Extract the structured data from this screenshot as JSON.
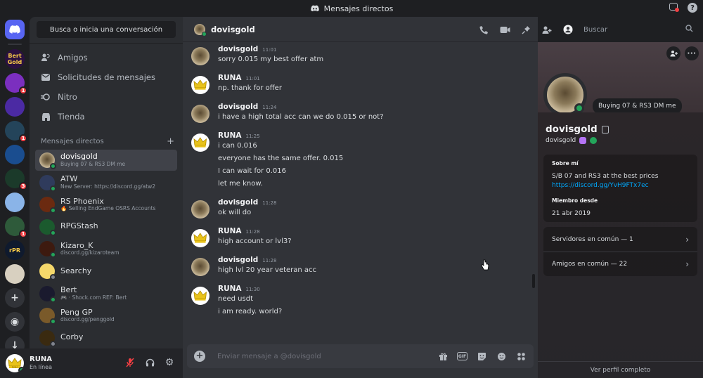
{
  "titlebar": {
    "title": "Mensajes directos"
  },
  "servers": [
    {
      "name": "discord-home",
      "label": "",
      "color": "#5865f2"
    },
    {
      "name": "bert-gold",
      "label": "Bert Gold",
      "color": "#2b1140"
    },
    {
      "name": "server-2",
      "label": "",
      "color": "#7b2fbf",
      "badge": "1"
    },
    {
      "name": "server-3",
      "label": "",
      "color": "#4b2aa3"
    },
    {
      "name": "server-4",
      "label": "",
      "color": "#24445a",
      "badge": "1"
    },
    {
      "name": "server-5",
      "label": "",
      "color": "#1a4d8f"
    },
    {
      "name": "server-6",
      "label": "",
      "color": "#1b3a2a",
      "badge": "3"
    },
    {
      "name": "server-7",
      "label": "",
      "color": "#8ab4e8"
    },
    {
      "name": "server-8",
      "label": "",
      "color": "#2e5a3a",
      "badge": "1"
    },
    {
      "name": "server-9",
      "label": "rPR",
      "color": "#0f1a2e"
    },
    {
      "name": "server-10",
      "label": "",
      "color": "#d8d0c0"
    }
  ],
  "sidebar": {
    "search_label": "Busca o inicia una conversación",
    "nav": [
      {
        "label": "Amigos",
        "icon": "friends-icon"
      },
      {
        "label": "Solicitudes de mensajes",
        "icon": "mail-icon"
      },
      {
        "label": "Nitro",
        "icon": "nitro-icon"
      },
      {
        "label": "Tienda",
        "icon": "shop-icon"
      }
    ],
    "dm_header": "Mensajes directos",
    "dms": [
      {
        "name": "dovisgold",
        "sub": "Buying 07 & RS3 DM me",
        "status": "online",
        "active": true
      },
      {
        "name": "ATW",
        "sub": "New Server: https://discord.gg/atw2",
        "status": "online"
      },
      {
        "name": "RS Phoenix",
        "sub": "🔥 Selling EndGame OSRS Accounts",
        "status": "online"
      },
      {
        "name": "RPGStash",
        "sub": "",
        "status": "online"
      },
      {
        "name": "Kizaro_K",
        "sub": "discord.gg/kizaroteam",
        "status": "online"
      },
      {
        "name": "Searchy",
        "sub": "",
        "status": "off"
      },
      {
        "name": "Bert",
        "sub": "🎮 · Shock.com REF: Bert",
        "status": "online"
      },
      {
        "name": "Peng GP",
        "sub": "discord.gg/penggold",
        "status": "online"
      },
      {
        "name": "Corby",
        "sub": "",
        "status": "off"
      }
    ]
  },
  "user": {
    "name": "RUNA",
    "status": "En línea"
  },
  "chat": {
    "recipient": "dovisgold",
    "search_placeholder": "Buscar",
    "composer_placeholder": "Enviar mensaje a @dovisgold",
    "messages": [
      {
        "author": "dovisgold",
        "time": "11:01",
        "lines": [
          "sorry 0.015 my best offer atm"
        ],
        "avatar": "owl"
      },
      {
        "author": "RUNA",
        "time": "11:01",
        "lines": [
          "np. thank for offer"
        ],
        "avatar": "crown"
      },
      {
        "author": "dovisgold",
        "time": "11:24",
        "lines": [
          "i have a high total acc can we do 0.015 or not?"
        ],
        "avatar": "owl"
      },
      {
        "author": "RUNA",
        "time": "11:25",
        "lines": [
          "i can 0.016",
          "everyone has the same offer. 0.015",
          "I can wait for 0.016",
          "let me know."
        ],
        "avatar": "crown"
      },
      {
        "author": "dovisgold",
        "time": "11:28",
        "lines": [
          "ok will do"
        ],
        "avatar": "owl"
      },
      {
        "author": "RUNA",
        "time": "11:28",
        "lines": [
          "high account or lvl3?"
        ],
        "avatar": "crown"
      },
      {
        "author": "dovisgold",
        "time": "11:28",
        "lines": [
          "high lvl 20 year veteran acc"
        ],
        "avatar": "owl"
      },
      {
        "author": "RUNA",
        "time": "11:30",
        "lines": [
          "need usdt",
          "i am ready. world?"
        ],
        "avatar": "crown"
      }
    ]
  },
  "profile": {
    "display_name": "dovisgold",
    "username": "dovisgold",
    "custom_status": "Buying 07 & RS3 DM me",
    "about_title": "Sobre mí",
    "about_text": "S/B 07 and RS3 at the best prices",
    "about_link": "https://discord.gg/YvH9FTx7ec",
    "member_since_title": "Miembro desde",
    "member_since": "21 abr 2019",
    "mutual_servers": "Servidores en común — 1",
    "mutual_friends": "Amigos en común — 22",
    "view_full": "Ver perfil completo"
  }
}
